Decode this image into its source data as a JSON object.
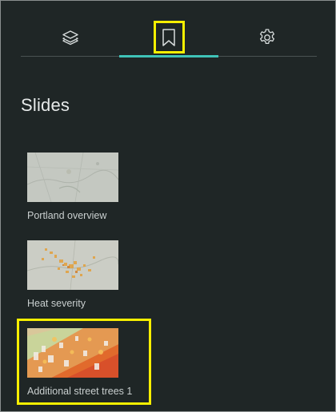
{
  "tabs": [
    {
      "icon": "layers-icon"
    },
    {
      "icon": "bookmark-icon",
      "active": true
    },
    {
      "icon": "gear-icon"
    }
  ],
  "panel": {
    "title": "Slides"
  },
  "slides": [
    {
      "label": "Portland overview"
    },
    {
      "label": "Heat severity"
    },
    {
      "label": "Additional street trees 1"
    }
  ],
  "colors": {
    "background": "#1f2626",
    "accent": "#3fc3b8",
    "highlight": "#f7ef00"
  }
}
